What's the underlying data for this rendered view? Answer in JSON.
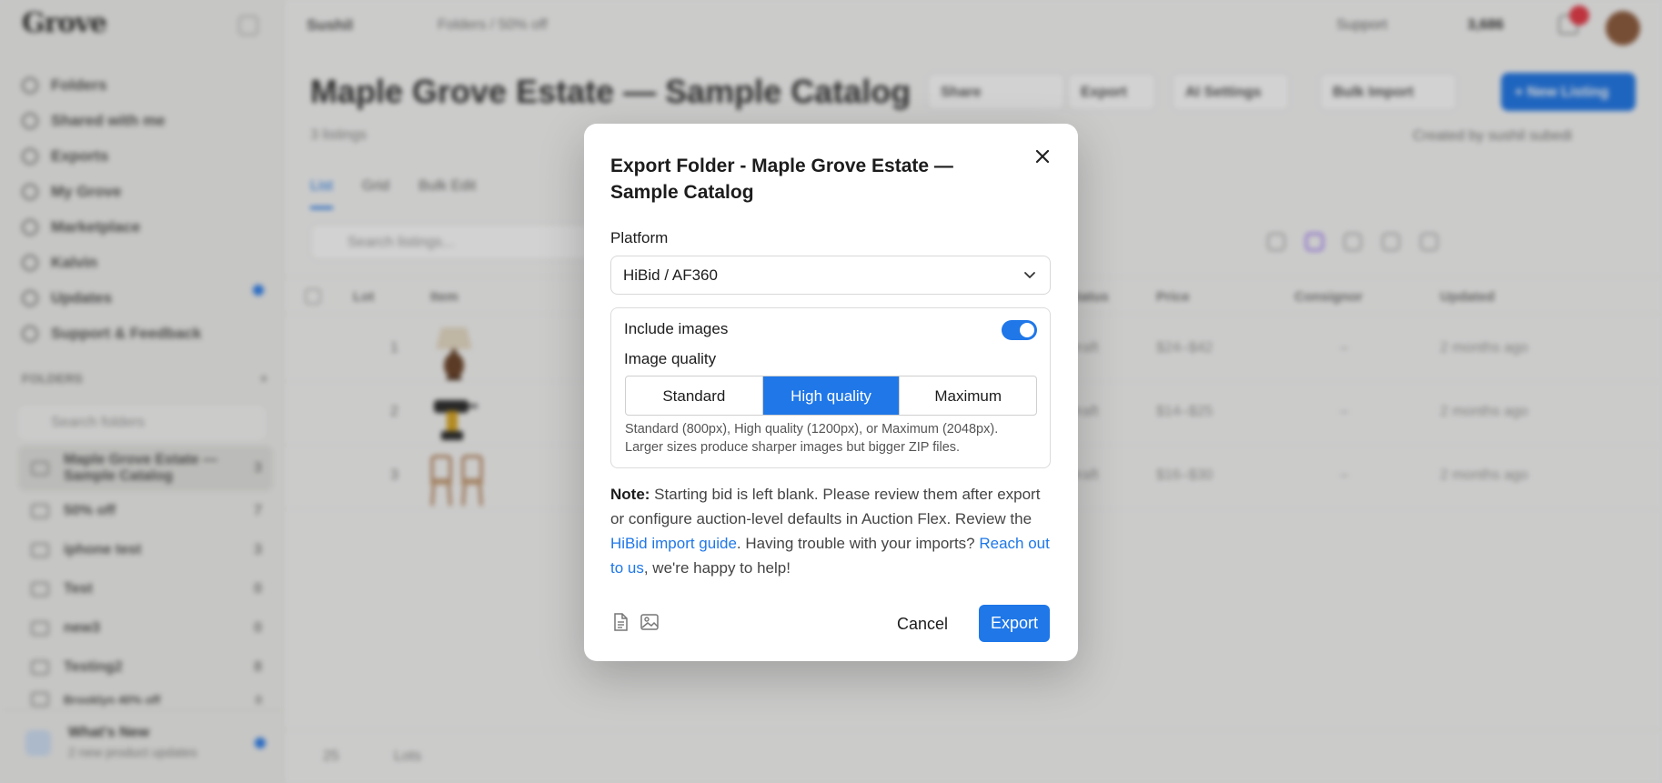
{
  "app": {
    "logo": "Grove",
    "sidebar": {
      "nav": [
        "Folders",
        "Shared with me",
        "Exports",
        "My Grove",
        "Marketplace",
        "Kalvin",
        "Updates",
        "Support & Feedback"
      ],
      "folders_label": "FOLDERS",
      "folder_search_placeholder": "Search folders",
      "folders": [
        {
          "name": "Maple Grove Estate — Sample Catalog",
          "count": "3"
        },
        {
          "name": "50% off",
          "count": "7"
        },
        {
          "name": "iphone test",
          "count": "3"
        },
        {
          "name": "Test",
          "count": "0"
        },
        {
          "name": "new3",
          "count": "0"
        },
        {
          "name": "Testing2",
          "count": "8"
        },
        {
          "name": "Brooklyn 40% off",
          "count": "0"
        }
      ],
      "whats_new_title": "What's New",
      "whats_new_sub": "2 new product updates"
    },
    "topbar": {
      "workspace": "Sushil",
      "breadcrumb": "Folders  /  50% off",
      "support": "Support",
      "credits": "3,686"
    },
    "header": {
      "title": "Maple Grove Estate — Sample Catalog",
      "subtitle": "3 listings",
      "share": "Share",
      "export": "Export",
      "ai_settings": "AI Settings",
      "bulk_import": "Bulk Import",
      "new_listing": "+ New Listing",
      "created_by": "Created by  sushil subedi"
    },
    "tabs": [
      "List",
      "Grid",
      "Bulk Edit"
    ],
    "list_search_placeholder": "Search listings...",
    "columns": [
      "Lot",
      "Item",
      "Status",
      "Price",
      "Consignor",
      "Updated"
    ],
    "rows": [
      {
        "lot": "1",
        "status": "Draft",
        "price": "$24–$42",
        "consignor": "–",
        "updated": "2 months ago"
      },
      {
        "lot": "2",
        "status": "Draft",
        "price": "$14–$25",
        "consignor": "–",
        "updated": "2 months ago"
      },
      {
        "lot": "3",
        "status": "Draft",
        "price": "$16–$30",
        "consignor": "–",
        "updated": "2 months ago"
      }
    ],
    "footer_per_page": "25",
    "footer_label": "Lots"
  },
  "modal": {
    "title": "Export Folder - Maple Grove Estate — Sample Catalog",
    "platform_label": "Platform",
    "platform_value": "HiBid / AF360",
    "include_images_label": "Include images",
    "include_images": true,
    "image_quality_label": "Image quality",
    "quality_options": [
      "Standard",
      "High quality",
      "Maximum"
    ],
    "quality_selected": "High quality",
    "quality_help": "Standard (800px), High quality (1200px), or Maximum (2048px). Larger sizes produce sharper images but bigger ZIP files.",
    "note": {
      "prefix": "Note:",
      "text1": " Starting bid is left blank. Please review them after export or configure auction-level defaults in Auction Flex. Review the ",
      "link1": "HiBid import guide",
      "text2": ". Having trouble with your imports? ",
      "link2": "Reach out to us",
      "text3": ", we're happy to help!"
    },
    "cancel_label": "Cancel",
    "export_label": "Export"
  },
  "colors": {
    "accent": "#1f77e8",
    "notification": "#e63946"
  }
}
